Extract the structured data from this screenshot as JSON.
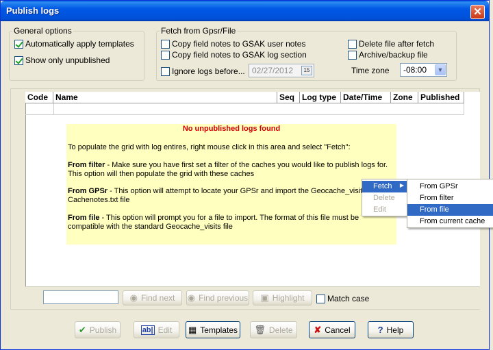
{
  "window": {
    "title": "Publish logs",
    "close_glyph": "✕"
  },
  "general_options": {
    "legend": "General options",
    "auto_apply_templates": {
      "label": "Automatically apply templates",
      "checked": true
    },
    "show_only_unpublished": {
      "label": "Show only unpublished",
      "checked": true
    }
  },
  "fetch": {
    "legend": "Fetch from Gpsr/File",
    "copy_user_notes": {
      "label": "Copy field notes to GSAK user notes",
      "checked": false
    },
    "copy_log_section": {
      "label": "Copy field notes to GSAK log section",
      "checked": false
    },
    "ignore_logs_before": {
      "label": "Ignore logs before...",
      "checked": false
    },
    "date_value": "02/27/2012",
    "delete_after_fetch": {
      "label": "Delete file after fetch",
      "checked": false
    },
    "archive_backup": {
      "label": "Archive/backup file",
      "checked": false
    },
    "timezone_label": "Time zone",
    "timezone_value": "-08:00"
  },
  "grid": {
    "columns": [
      "Code",
      "Name",
      "Seq",
      "Log type",
      "Date/Time",
      "Zone",
      "Published"
    ]
  },
  "note": {
    "title": "No unpublished logs found",
    "intro": "To populate the grid with log entires, right mouse click in this area and select \"Fetch\":",
    "from_filter_bold": "From filter",
    "from_filter_text": " - Make sure you have first set a filter of the caches you would like to publish logs for. This option will then populate the grid with these caches",
    "from_gpsr_bold": "From GPSr",
    "from_gpsr_text": " - This option will attempt to locate your GPSr and import the Geocache_visits.txt or Cachenotes.txt file",
    "from_file_bold": "From file",
    "from_file_text": " - This option will prompt you for a file to import. The format of this file must be compatible with the standard Geocache_visits file"
  },
  "context_menu": {
    "items": [
      {
        "label": "Fetch",
        "state": "active"
      },
      {
        "label": "Delete",
        "state": "disabled"
      },
      {
        "label": "Edit",
        "state": "disabled"
      }
    ],
    "submenu": [
      "From GPSr",
      "From filter",
      "From file",
      "From current cache"
    ],
    "submenu_active": "From file"
  },
  "find_bar": {
    "find_next": "Find next",
    "find_previous": "Find previous",
    "highlight": "Highlight",
    "match_case": {
      "label": "Match case",
      "checked": false
    }
  },
  "buttons": {
    "publish": "Publish",
    "edit": "Edit",
    "templates": "Templates",
    "delete": "Delete",
    "cancel": "Cancel",
    "help": "Help"
  }
}
